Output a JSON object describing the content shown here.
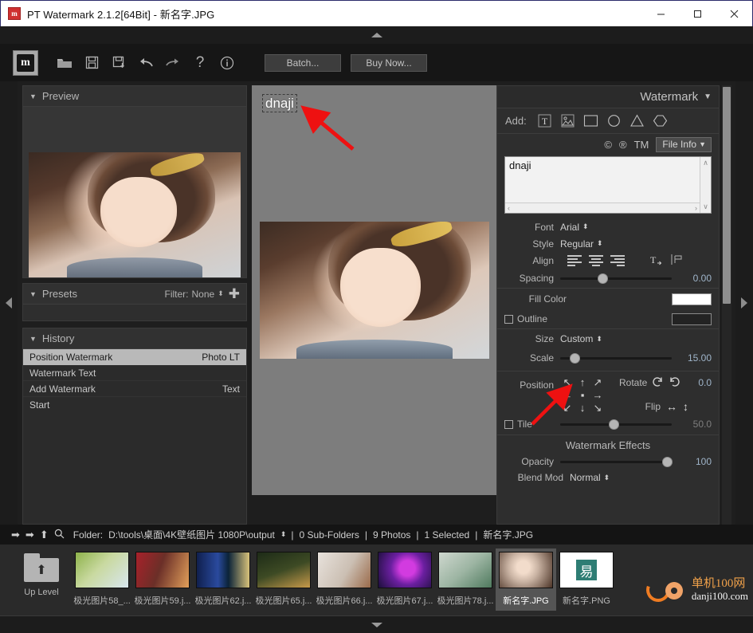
{
  "window": {
    "title": "PT Watermark 2.1.2[64Bit] - 新名字.JPG",
    "app_icon": "stamp-icon",
    "minimize": "—",
    "maximize": "▢",
    "close": "✕"
  },
  "toolbar": {
    "logo_letter": "m",
    "icons": [
      "folder-open-icon",
      "save-icon",
      "save-as-icon",
      "undo-icon",
      "redo-icon",
      "help-icon",
      "info-icon"
    ],
    "batch_label": "Batch...",
    "buy_label": "Buy Now..."
  },
  "left": {
    "preview": {
      "title": "Preview",
      "caret": "▼"
    },
    "presets": {
      "title": "Presets",
      "caret": "▼",
      "filter_label": "Filter:",
      "filter_value": "None",
      "add_icon": "plus-icon"
    },
    "history": {
      "title": "History",
      "caret": "▼",
      "rows": [
        {
          "name": "Position Watermark",
          "value": "Photo LT",
          "selected": true
        },
        {
          "name": "Watermark Text",
          "value": "",
          "selected": false
        },
        {
          "name": "Add Watermark",
          "value": "Text",
          "selected": false
        },
        {
          "name": "Start",
          "value": "",
          "selected": false
        }
      ]
    }
  },
  "canvas": {
    "watermark_text": "dnaji"
  },
  "right": {
    "header": {
      "title": "Watermark",
      "caret": "▼"
    },
    "add": {
      "label": "Add:",
      "items": [
        "text-icon",
        "image-icon",
        "rectangle-icon",
        "circle-icon",
        "triangle-icon",
        "hexagon-icon"
      ]
    },
    "marks": {
      "copyright": "©",
      "registered": "®",
      "trademark": "TM",
      "file_info": "File Info",
      "file_info_caret": "▼"
    },
    "text_value": "dnaji",
    "font": {
      "label": "Font",
      "value": "Arial"
    },
    "style": {
      "label": "Style",
      "value": "Regular"
    },
    "align": {
      "label": "Align",
      "icons": [
        "align-left-icon",
        "align-center-icon",
        "align-right-icon",
        "text-direction-icon",
        "text-baseline-icon"
      ]
    },
    "spacing": {
      "label": "Spacing",
      "value": "0.00",
      "percent": 38
    },
    "fill_color": {
      "label": "Fill Color",
      "swatch": "#ffffff"
    },
    "outline": {
      "label": "Outline",
      "swatch": "#232323",
      "checked": false
    },
    "size": {
      "label": "Size",
      "value": "Custom"
    },
    "scale": {
      "label": "Scale",
      "value": "15.00",
      "percent": 13
    },
    "position": {
      "label": "Position",
      "arrows": [
        "↖",
        "↑",
        "↗",
        "←",
        "▪",
        "→",
        "↙",
        "↓",
        "↘"
      ]
    },
    "rotate": {
      "label": "Rotate",
      "ccw_icon": "rotate-ccw-icon",
      "cw_icon": "rotate-cw-icon",
      "value": "0.0"
    },
    "flip": {
      "label": "Flip",
      "horizontal_icon": "flip-horizontal-icon",
      "vertical_icon": "flip-vertical-icon"
    },
    "tile": {
      "label": "Tile",
      "checked": false,
      "value": "50.0",
      "percent": 48
    },
    "effects": {
      "title": "Watermark Effects"
    },
    "opacity": {
      "label": "Opacity",
      "value": "100",
      "percent": 96
    },
    "blend": {
      "label": "Blend Mod",
      "value": "Normal"
    }
  },
  "status": {
    "back_icon": "arrow-left-icon",
    "forward_icon": "arrow-right-icon",
    "up_icon": "arrow-up-icon",
    "search_icon": "search-icon",
    "folder_label": "Folder:",
    "folder_path": "D:\\tools\\桌面\\4K壁纸图片 1080P\\output",
    "sub_folders": "0 Sub-Folders",
    "photos": "9 Photos",
    "selected": "1 Selected",
    "current_file": "新名字.JPG",
    "separator": "|"
  },
  "filmstrip": {
    "up_level": {
      "label": "Up Level",
      "icon": "folder-up-icon"
    },
    "items": [
      {
        "label": "极光图片58_...",
        "selected": false,
        "c1": "#8db24a",
        "c2": "#d8e6ef"
      },
      {
        "label": "极光图片59.j...",
        "selected": false,
        "c1": "#a8212a",
        "c2": "#e2a05a"
      },
      {
        "label": "极光图片62.j...",
        "selected": false,
        "c1": "#10204e",
        "c2": "#3f7fd0"
      },
      {
        "label": "极光图片65.j...",
        "selected": false,
        "c1": "#1d2b17",
        "c2": "#c79a4a"
      },
      {
        "label": "极光图片66.j...",
        "selected": false,
        "c1": "#e8e2dc",
        "c2": "#9a6a4a"
      },
      {
        "label": "极光图片67.j...",
        "selected": false,
        "c1": "#1b0f3a",
        "c2": "#d23be0"
      },
      {
        "label": "极光图片78.j...",
        "selected": false,
        "c1": "#cfd8cf",
        "c2": "#4f7a5e"
      },
      {
        "label": "新名字.JPG",
        "selected": true,
        "c1": "#d9c9be",
        "c2": "#4b3326"
      },
      {
        "label": "新名字.PNG",
        "selected": false,
        "c1": "#ffffff",
        "c2": "#2e7d74"
      }
    ]
  },
  "site_logo": {
    "line1": "单机100网",
    "line2": "danji100.com"
  }
}
